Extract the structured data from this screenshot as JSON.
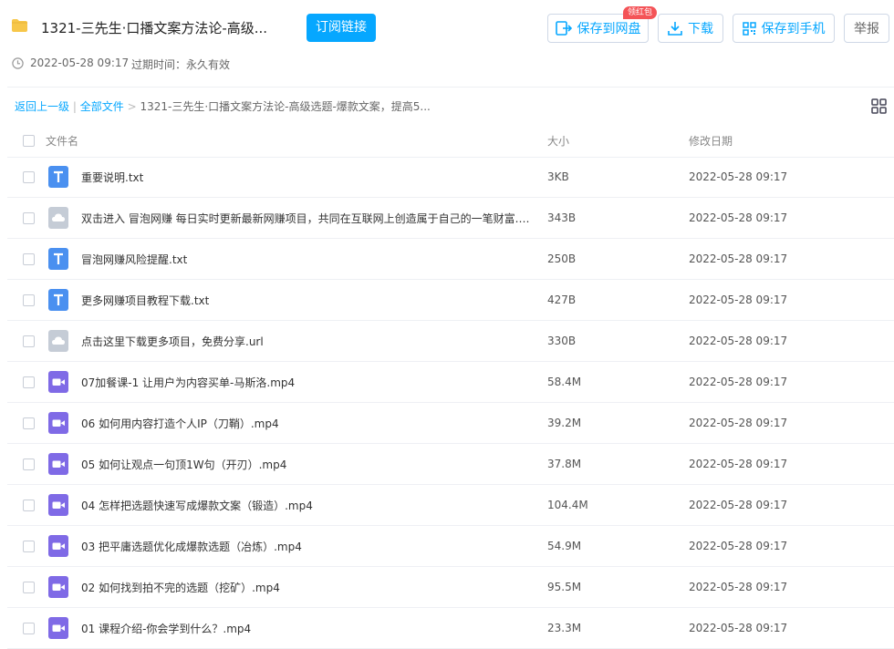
{
  "header": {
    "title": "1321-三先生·口播文案方法论-高级...",
    "subscribe_label": "订阅链接",
    "save_to_cloud_label": "保存到网盘",
    "save_badge": "领红包",
    "download_label": "下载",
    "save_to_phone_label": "保存到手机",
    "report_label": "举报",
    "share_time": "2022-05-28 09:17",
    "expire_text": "过期时间：永久有效"
  },
  "breadcrumb": {
    "back": "返回上一级",
    "divider": "|",
    "all_files": "全部文件",
    "separator": ">",
    "current": "1321-三先生·口播文案方法论-高级选题-爆款文案，提高5..."
  },
  "table": {
    "col_name": "文件名",
    "col_size": "大小",
    "col_date": "修改日期",
    "rows": [
      {
        "name": "重要说明.txt",
        "size": "3KB",
        "date": "2022-05-28 09:17",
        "icon": "txt"
      },
      {
        "name": "双击进入 冒泡网赚 每日实时更新最新网赚项目，共同在互联网上创造属于自己的一笔财富.url",
        "size": "343B",
        "date": "2022-05-28 09:17",
        "icon": "url"
      },
      {
        "name": "冒泡网赚风险提醒.txt",
        "size": "250B",
        "date": "2022-05-28 09:17",
        "icon": "txt"
      },
      {
        "name": "更多网赚项目教程下载.txt",
        "size": "427B",
        "date": "2022-05-28 09:17",
        "icon": "txt"
      },
      {
        "name": "点击这里下载更多项目，免费分享.url",
        "size": "330B",
        "date": "2022-05-28 09:17",
        "icon": "url"
      },
      {
        "name": "07加餐课-1 让用户为内容买单-马斯洛.mp4",
        "size": "58.4M",
        "date": "2022-05-28 09:17",
        "icon": "video"
      },
      {
        "name": "06 如何用内容打造个人IP（刀鞘）.mp4",
        "size": "39.2M",
        "date": "2022-05-28 09:17",
        "icon": "video"
      },
      {
        "name": "05 如何让观点一句顶1W句（开刃）.mp4",
        "size": "37.8M",
        "date": "2022-05-28 09:17",
        "icon": "video"
      },
      {
        "name": "04 怎样把选题快速写成爆款文案（锻造）.mp4",
        "size": "104.4M",
        "date": "2022-05-28 09:17",
        "icon": "video"
      },
      {
        "name": "03 把平庸选题优化成爆款选题（冶炼）.mp4",
        "size": "54.9M",
        "date": "2022-05-28 09:17",
        "icon": "video"
      },
      {
        "name": "02 如何找到拍不完的选题（挖矿）.mp4",
        "size": "95.5M",
        "date": "2022-05-28 09:17",
        "icon": "video"
      },
      {
        "name": "01 课程介绍-你会学到什么？.mp4",
        "size": "23.3M",
        "date": "2022-05-28 09:17",
        "icon": "video"
      }
    ]
  },
  "colors": {
    "accent": "#06a7ff",
    "txt_icon": "#4a90f0",
    "url_icon": "#c5ccd6",
    "video_icon": "#7f6ae6",
    "folder": "#f7c74a",
    "badge": "#f45357"
  }
}
